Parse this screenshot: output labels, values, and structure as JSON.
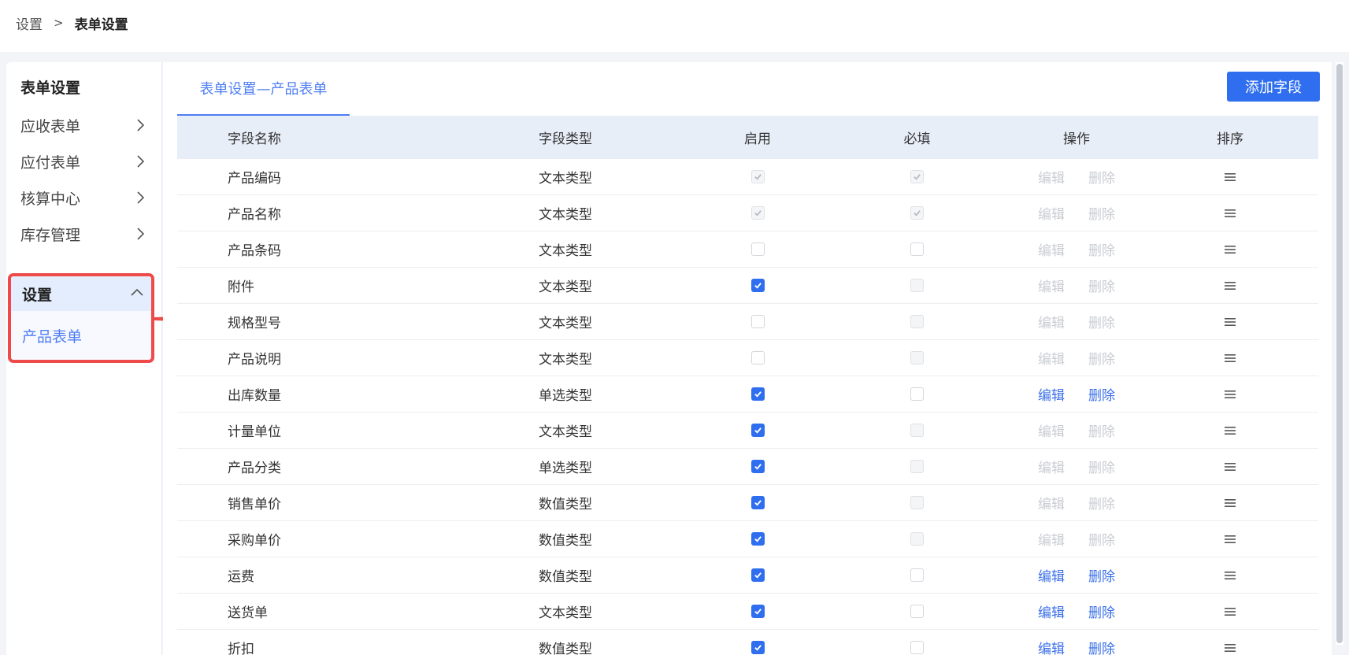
{
  "breadcrumb": {
    "root": "设置",
    "separator": ">",
    "current": "表单设置"
  },
  "sidebar": {
    "title": "表单设置",
    "items": [
      {
        "label": "应收表单"
      },
      {
        "label": "应付表单"
      },
      {
        "label": "核算中心"
      },
      {
        "label": "库存管理"
      }
    ],
    "settings": {
      "label": "设置",
      "sub_item": "产品表单"
    }
  },
  "tab": {
    "label": "表单设置—产品表单"
  },
  "add_button": "添加字段",
  "table": {
    "headers": {
      "name": "字段名称",
      "type": "字段类型",
      "enabled": "启用",
      "required": "必填",
      "actions": "操作",
      "sort": "排序"
    },
    "edit_label": "编辑",
    "delete_label": "删除",
    "rows": [
      {
        "name": "产品编码",
        "type": "文本类型",
        "enabled": "checked-disabled",
        "required": "checked-disabled",
        "actions_active": false
      },
      {
        "name": "产品名称",
        "type": "文本类型",
        "enabled": "checked-disabled",
        "required": "checked-disabled",
        "actions_active": false
      },
      {
        "name": "产品条码",
        "type": "文本类型",
        "enabled": "unchecked",
        "required": "unchecked",
        "actions_active": false
      },
      {
        "name": "附件",
        "type": "文本类型",
        "enabled": "checked",
        "required": "unchecked-disabled",
        "actions_active": false
      },
      {
        "name": "规格型号",
        "type": "文本类型",
        "enabled": "unchecked",
        "required": "unchecked-disabled",
        "actions_active": false
      },
      {
        "name": "产品说明",
        "type": "文本类型",
        "enabled": "unchecked",
        "required": "unchecked-disabled",
        "actions_active": false
      },
      {
        "name": "出库数量",
        "type": "单选类型",
        "enabled": "checked",
        "required": "unchecked",
        "actions_active": true
      },
      {
        "name": "计量单位",
        "type": "文本类型",
        "enabled": "checked",
        "required": "unchecked-disabled",
        "actions_active": false
      },
      {
        "name": "产品分类",
        "type": "单选类型",
        "enabled": "checked",
        "required": "unchecked-disabled",
        "actions_active": false
      },
      {
        "name": "销售单价",
        "type": "数值类型",
        "enabled": "checked",
        "required": "unchecked-disabled",
        "actions_active": false
      },
      {
        "name": "采购单价",
        "type": "数值类型",
        "enabled": "checked",
        "required": "unchecked-disabled",
        "actions_active": false
      },
      {
        "name": "运费",
        "type": "数值类型",
        "enabled": "checked",
        "required": "unchecked",
        "actions_active": true
      },
      {
        "name": "送货单",
        "type": "文本类型",
        "enabled": "checked",
        "required": "unchecked",
        "actions_active": true
      },
      {
        "name": "折扣",
        "type": "数值类型",
        "enabled": "checked",
        "required": "unchecked",
        "actions_active": true
      }
    ]
  },
  "colors": {
    "accent": "#2f6fef",
    "link": "#3a6fe8",
    "highlight_border": "#ef4a4a",
    "header_bg": "#e8eef8",
    "disabled_text": "#c9ccd2"
  },
  "icons": {
    "chevron_right": "chevron-right-icon",
    "chevron_up": "chevron-up-icon",
    "drag_handle": "drag-handle-icon",
    "checkmark": "check-icon",
    "annotation_arrow": "red-arrow"
  }
}
